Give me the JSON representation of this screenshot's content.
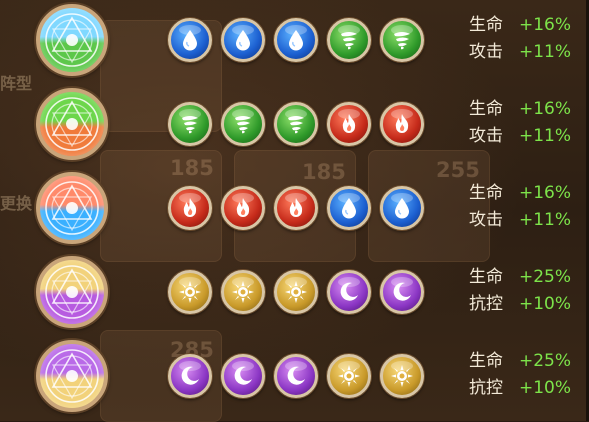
{
  "background": {
    "side_label_1": "阵型",
    "side_label_2": "更换",
    "card_numbers": [
      "185",
      "185",
      "255",
      "285"
    ]
  },
  "rows": [
    {
      "emblem": "water-wind-emblem-icon",
      "orbs": [
        "water",
        "water",
        "water",
        "wind",
        "wind"
      ],
      "stats": [
        {
          "label": "生命",
          "value": "+16%"
        },
        {
          "label": "攻击",
          "value": "+11%"
        }
      ]
    },
    {
      "emblem": "wind-fire-emblem-icon",
      "orbs": [
        "wind",
        "wind",
        "wind",
        "fire",
        "fire"
      ],
      "stats": [
        {
          "label": "生命",
          "value": "+16%"
        },
        {
          "label": "攻击",
          "value": "+11%"
        }
      ]
    },
    {
      "emblem": "fire-water-emblem-icon",
      "orbs": [
        "fire",
        "fire",
        "fire",
        "water",
        "water"
      ],
      "stats": [
        {
          "label": "生命",
          "value": "+16%"
        },
        {
          "label": "攻击",
          "value": "+11%"
        }
      ]
    },
    {
      "emblem": "light-dark-emblem-icon",
      "orbs": [
        "light",
        "light",
        "light",
        "dark",
        "dark"
      ],
      "stats": [
        {
          "label": "生命",
          "value": "+25%"
        },
        {
          "label": "抗控",
          "value": "+10%"
        }
      ]
    },
    {
      "emblem": "dark-light-emblem-icon",
      "orbs": [
        "dark",
        "dark",
        "dark",
        "light",
        "light"
      ],
      "stats": [
        {
          "label": "生命",
          "value": "+25%"
        },
        {
          "label": "抗控",
          "value": "+10%"
        }
      ]
    }
  ]
}
